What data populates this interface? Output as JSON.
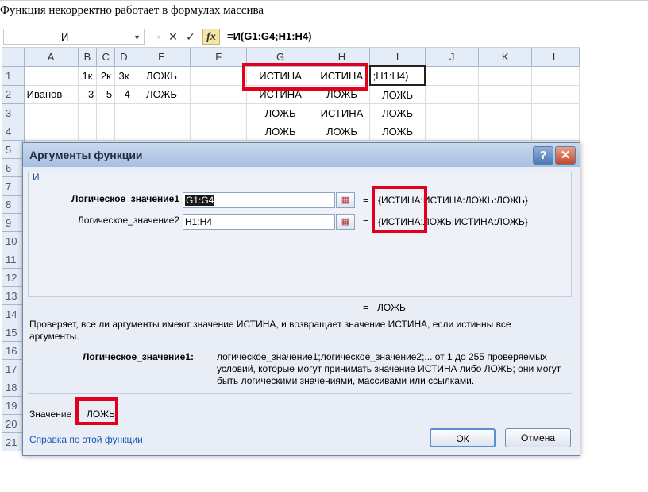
{
  "page_title": "Функция некорректно работает в формулах массива",
  "formula_bar": {
    "name_box": "И",
    "cancel_icon": "✕",
    "enter_icon": "✓",
    "fx_label": "fx",
    "formula": "=И(G1:G4;H1:H4)"
  },
  "columns": [
    "A",
    "B",
    "C",
    "D",
    "E",
    "F",
    "G",
    "H",
    "I",
    "J",
    "K",
    "L"
  ],
  "rows": [
    {
      "n": "1",
      "A": "",
      "B": "1к",
      "C": "2к",
      "D": "3к",
      "E": "ЛОЖЬ",
      "F": "",
      "G": "ИСТИНА",
      "H": "ИСТИНА",
      "I": ";H1:H4)"
    },
    {
      "n": "2",
      "A": "Иванов",
      "B": "3",
      "C": "5",
      "D": "4",
      "E": "ЛОЖЬ",
      "F": "",
      "G": "ИСТИНА",
      "H": "ЛОЖЬ",
      "I": "ЛОЖЬ"
    },
    {
      "n": "3",
      "A": "",
      "B": "",
      "C": "",
      "D": "",
      "E": "",
      "F": "",
      "G": "ЛОЖЬ",
      "H": "ИСТИНА",
      "I": "ЛОЖЬ"
    },
    {
      "n": "4",
      "A": "",
      "B": "",
      "C": "",
      "D": "",
      "E": "",
      "F": "",
      "G": "ЛОЖЬ",
      "H": "ЛОЖЬ",
      "I": "ЛОЖЬ"
    }
  ],
  "row_numbers": [
    "5",
    "6",
    "7",
    "8",
    "9",
    "10",
    "11",
    "12",
    "13",
    "14",
    "15",
    "16",
    "17",
    "18",
    "19",
    "20",
    "21"
  ],
  "dialog": {
    "title": "Аргументы функции",
    "help_icon": "?",
    "close_icon": "✕",
    "function_name": "И",
    "arg1_label": "Логическое_значение1",
    "arg1_value": "G1:G4",
    "arg1_result": "{ИСТИНА:ИСТИНА:ЛОЖЬ:ЛОЖЬ}",
    "arg2_label": "Логическое_значение2",
    "arg2_value": "H1:H4",
    "arg2_result": "{ИСТИНА:ЛОЖЬ:ИСТИНА:ЛОЖЬ}",
    "equals": "=",
    "formula_result": "ЛОЖЬ",
    "description": "Проверяет, все ли аргументы имеют значение ИСТИНА, и возвращает значение ИСТИНА, если истинны все аргументы.",
    "arg_help_label": "Логическое_значение1:",
    "arg_help_text": "логическое_значение1;логическое_значение2;... от 1 до 255 проверяемых условий, которые могут принимать значение ИСТИНА либо ЛОЖЬ; они могут быть логическими значениями, массивами или ссылками.",
    "value_label": "Значение",
    "value": "ЛОЖЬ",
    "help_link": "Справка по этой функции",
    "ok_label": "ОК",
    "cancel_label": "Отмена"
  },
  "colors": {
    "highlight_border": "#e0001b",
    "header_bg": "#e4ecf7",
    "dialog_bg": "#e9eef6"
  }
}
